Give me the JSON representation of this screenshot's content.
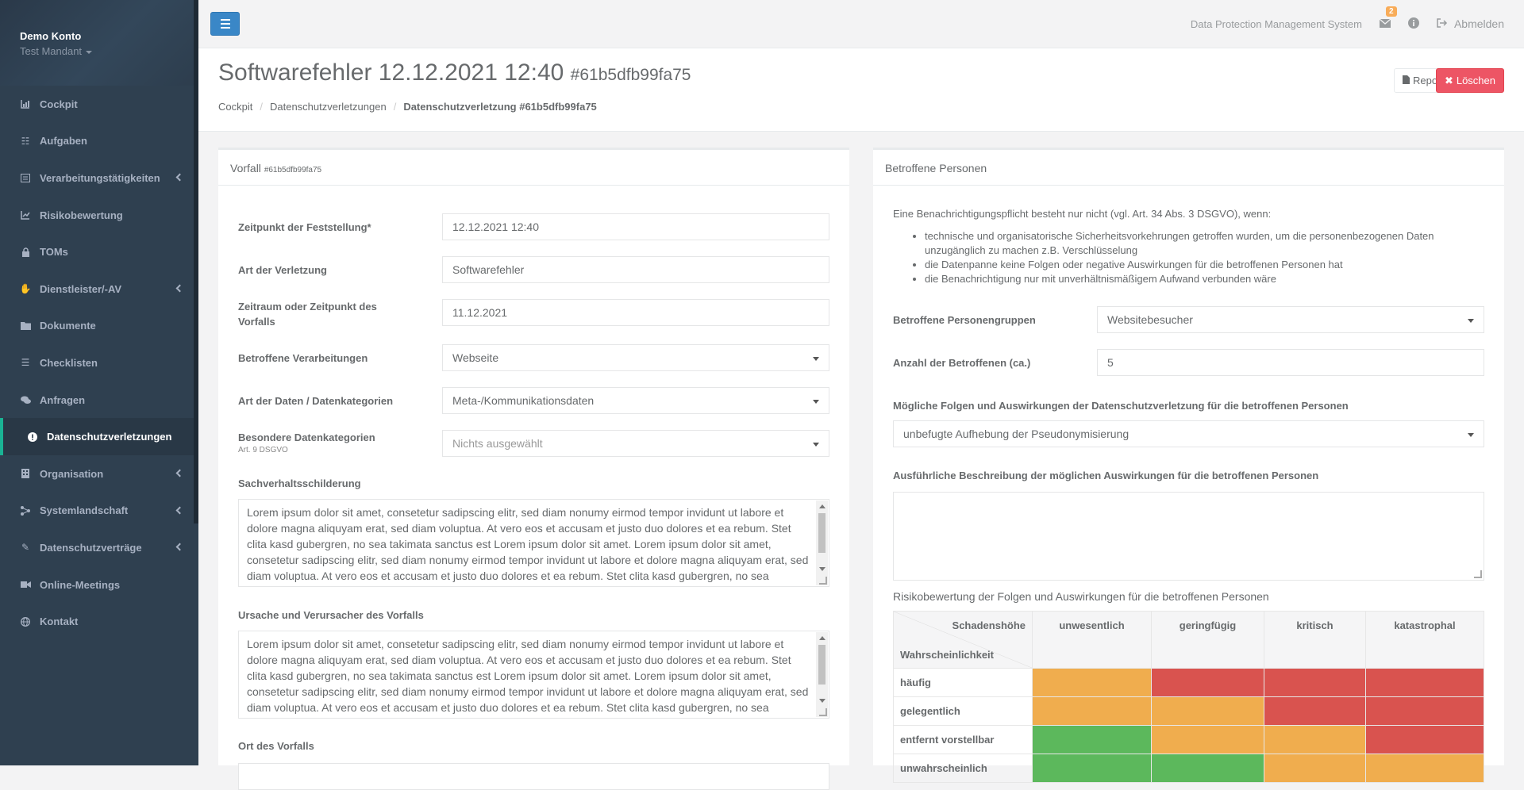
{
  "sidebar": {
    "account": "Demo Konto",
    "tenant": "Test Mandant",
    "items": [
      {
        "label": "Cockpit",
        "icon": "chart-icon"
      },
      {
        "label": "Aufgaben",
        "icon": "tasks-icon"
      },
      {
        "label": "Verarbeitungstätigkeiten",
        "icon": "list-alt-icon"
      },
      {
        "label": "Risikobewertung",
        "icon": "line-chart-icon"
      },
      {
        "label": "TOMs",
        "icon": "lock-icon"
      },
      {
        "label": "Dienstleister/-AV",
        "icon": "handshake-icon"
      },
      {
        "label": "Dokumente",
        "icon": "folder-icon"
      },
      {
        "label": "Checklisten",
        "icon": "list-icon"
      },
      {
        "label": "Anfragen",
        "icon": "comments-icon"
      },
      {
        "label": "Datenschutzverletzungen",
        "icon": "exclamation-icon"
      },
      {
        "label": "Organisation",
        "icon": "building-icon"
      },
      {
        "label": "Systemlandschaft",
        "icon": "network-icon"
      },
      {
        "label": "Datenschutzverträge",
        "icon": "edit-icon"
      },
      {
        "label": "Online-Meetings",
        "icon": "video-icon"
      },
      {
        "label": "Kontakt",
        "icon": "globe-icon"
      }
    ]
  },
  "topbar": {
    "system_name": "Data Protection Management System",
    "mail_count": "2",
    "logout": "Abmelden"
  },
  "header": {
    "title": "Softwarefehler 12.12.2021 12:40",
    "id": "#61b5dfb99fa75",
    "breadcrumb": [
      "Cockpit",
      "Datenschutzverletzungen",
      "Datenschutzverletzung #61b5dfb99fa75"
    ],
    "report_label": "Report",
    "delete_label": "Löschen"
  },
  "left": {
    "title": "Vorfall",
    "title_id": "#61b5dfb99fa75",
    "fields": {
      "detected_label": "Zeitpunkt der Feststellung*",
      "detected_value": "12.12.2021 12:40",
      "type_label": "Art der Verletzung",
      "type_value": "Softwarefehler",
      "period_label": "Zeitraum oder Zeitpunkt des Vorfalls",
      "period_value": "11.12.2021",
      "processing_label": "Betroffene Verarbeitungen",
      "processing_value": "Webseite",
      "datatype_label": "Art der Daten / Datenkategorien",
      "datatype_value": "Meta-/Kommunikationsdaten",
      "special_label": "Besondere Datenkategorien",
      "special_sub": "Art. 9 DSGVO",
      "special_placeholder": "Nichts ausgewählt",
      "facts_label": "Sachverhaltsschilderung",
      "facts_text": "Lorem ipsum dolor sit amet, consetetur sadipscing elitr, sed diam nonumy eirmod tempor invidunt ut labore et dolore magna aliquyam erat, sed diam voluptua. At vero eos et accusam et justo duo dolores et ea rebum. Stet clita kasd gubergren, no sea takimata sanctus est Lorem ipsum dolor sit amet. Lorem ipsum dolor sit amet, consetetur sadipscing elitr, sed diam nonumy eirmod tempor invidunt ut labore et dolore magna aliquyam erat, sed diam voluptua. At vero eos et accusam et justo duo dolores et ea rebum. Stet clita kasd gubergren, no sea takimata sanctus est Lorem ipsum dolor sit amet.",
      "cause_label": "Ursache und Verursacher des Vorfalls",
      "cause_text": "Lorem ipsum dolor sit amet, consetetur sadipscing elitr, sed diam nonumy eirmod tempor invidunt ut labore et dolore magna aliquyam erat, sed diam voluptua. At vero eos et accusam et justo duo dolores et ea rebum. Stet clita kasd gubergren, no sea takimata sanctus est Lorem ipsum dolor sit amet. Lorem ipsum dolor sit amet, consetetur sadipscing elitr, sed diam nonumy eirmod tempor invidunt ut labore et dolore magna aliquyam erat, sed diam voluptua. At vero eos et accusam et justo duo dolores et ea rebum. Stet clita kasd gubergren, no sea takimata sanctus est Lorem ipsum dolor sit amet.",
      "location_label": "Ort des Vorfalls"
    }
  },
  "right": {
    "title": "Betroffene Personen",
    "notice_intro": "Eine Benachrichtigungspflicht besteht nur nicht (vgl. Art. 34 Abs. 3 DSGVO), wenn:",
    "notice_items": [
      "technische und organisatorische Sicherheitsvorkehrungen getroffen wurden, um die personenbezogenen Daten unzugänglich zu machen z.B. Verschlüsselung",
      "die Datenpanne keine Folgen oder negative Auswirkungen für die betroffenen Personen hat",
      "die Benachrichtigung nur mit unverhältnismäßigem Aufwand verbunden wäre"
    ],
    "groups_label": "Betroffene Personengruppen",
    "groups_value": "Websitebesucher",
    "count_label": "Anzahl der Betroffenen (ca.)",
    "count_value": "5",
    "consequences_label": "Mögliche Folgen und Auswirkungen der Datenschutzverletzung für die betroffenen Personen",
    "consequences_value": "unbefugte Aufhebung der Pseudonymisierung",
    "description_label": "Ausführliche Beschreibung der möglichen Auswirkungen für die betroffenen Personen",
    "description_value": "",
    "risk": {
      "title": "Risikobewertung der Folgen und Auswirkungen für die betroffenen Personen",
      "corner_top": "Schadenshöhe",
      "corner_bottom": "Wahrscheinlichkeit",
      "columns": [
        "unwesentlich",
        "geringfügig",
        "kritisch",
        "katastrophal"
      ],
      "rows": [
        {
          "label": "häufig",
          "levels": [
            "orange",
            "red",
            "red",
            "red"
          ]
        },
        {
          "label": "gelegentlich",
          "levels": [
            "orange",
            "orange",
            "red",
            "red"
          ]
        },
        {
          "label": "entfernt vorstellbar",
          "levels": [
            "green",
            "orange",
            "orange",
            "red"
          ]
        },
        {
          "label": "unwahrscheinlich",
          "levels": [
            "green",
            "green",
            "orange",
            "orange"
          ]
        }
      ],
      "colors": {
        "green": "#5cb85c",
        "orange": "#f0ad4e",
        "red": "#d9534f"
      }
    }
  }
}
